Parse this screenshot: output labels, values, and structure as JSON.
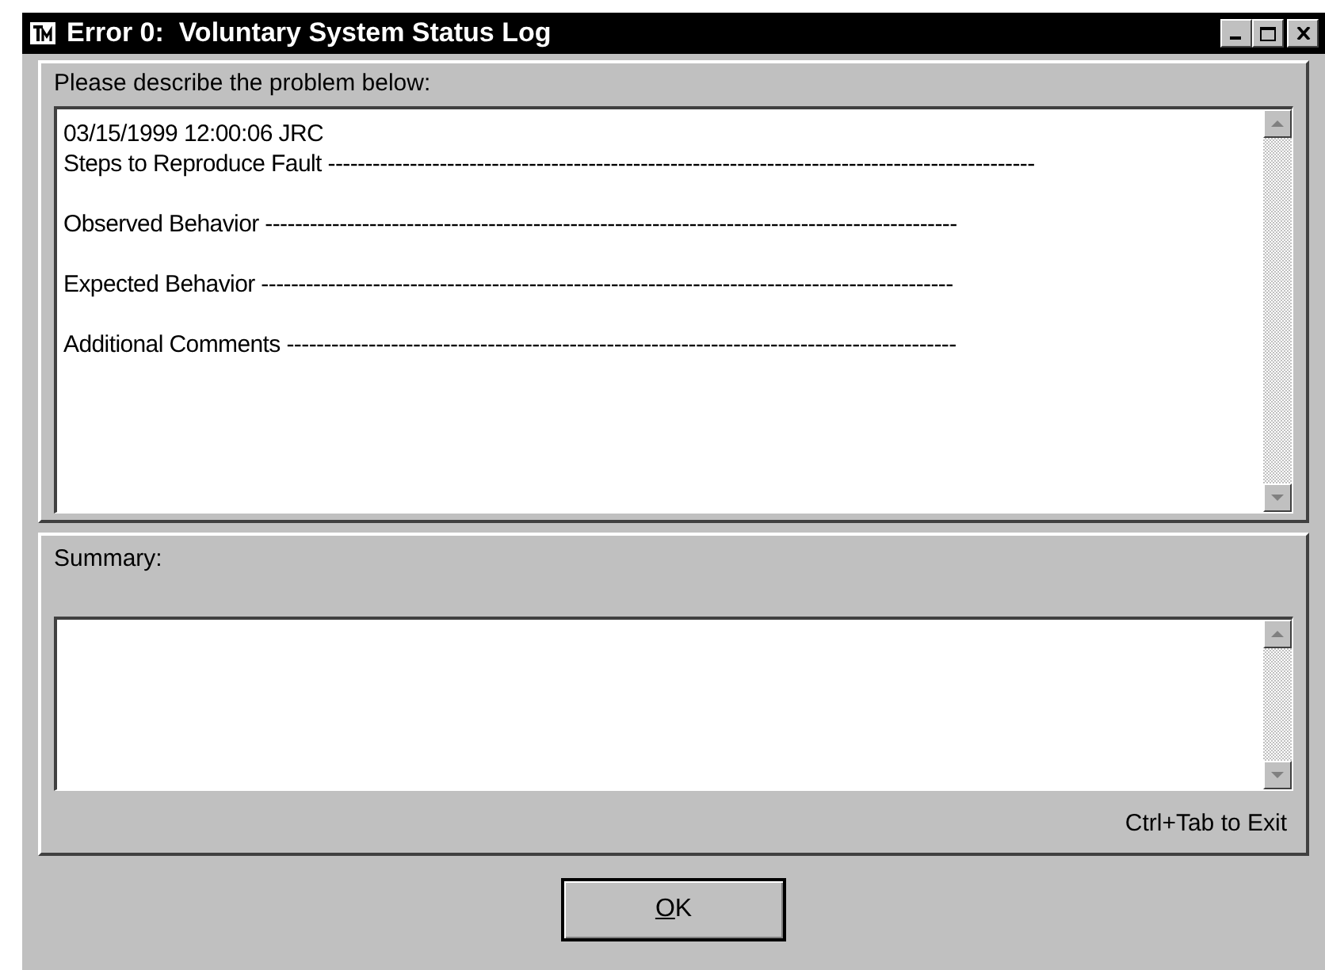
{
  "window": {
    "title": "Error 0:  Voluntary System Status Log"
  },
  "description": {
    "label": "Please describe the problem below:",
    "paragraphs": [
      [
        "03/15/1999 12:00:06 JRC",
        "Steps to Reproduce Fault -----------------------------------------------------------------------------------------------"
      ],
      [
        "Observed Behavior ---------------------------------------------------------------------------------------------"
      ],
      [
        "Expected Behavior ---------------------------------------------------------------------------------------------"
      ],
      [
        "Additional Comments ------------------------------------------------------------------------------------------"
      ]
    ]
  },
  "summary": {
    "label": "Summary:",
    "hint": "Ctrl+Tab to Exit"
  },
  "ok_button": {
    "label": "OK",
    "first_letter_underlined": true
  }
}
